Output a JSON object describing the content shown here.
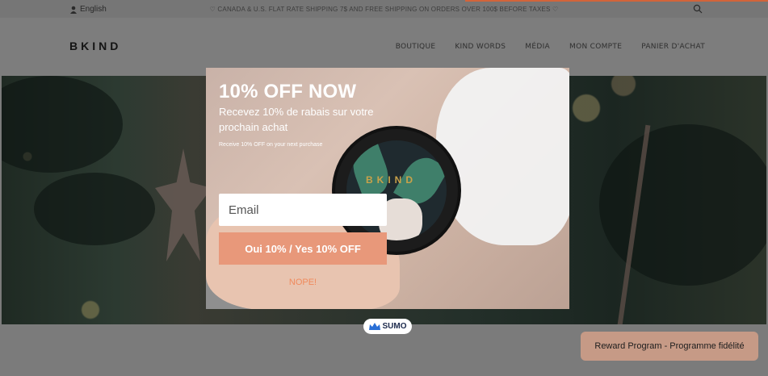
{
  "topbar": {
    "language": "English",
    "promo": "♡ CANADA & U.S. FLAT RATE SHIPPING 7$ AND FREE SHIPPING ON ORDERS OVER 100$ BEFORE TAXES ♡"
  },
  "header": {
    "logo": "BKIND",
    "nav": [
      "BOUTIQUE",
      "KIND WORDS",
      "MÉDIA",
      "MON COMPTE",
      "PANIER D'ACHAT"
    ]
  },
  "popup": {
    "title": "10% OFF NOW",
    "subtitle_fr": "Recevez 10% de rabais sur votre prochain achat",
    "subtitle_en": "Receive 10% OFF on your next purchase",
    "email_placeholder": "Email",
    "cta": "Oui 10% / Yes 10% OFF",
    "decline": "NOPE!",
    "product_brand": "BKIND"
  },
  "sumo_badge": "SUMO",
  "reward_button": "Reward Program - Programme fidélité",
  "colors": {
    "accent": "#e8987a",
    "decline": "#f08a5d",
    "reward": "#c69a86"
  }
}
